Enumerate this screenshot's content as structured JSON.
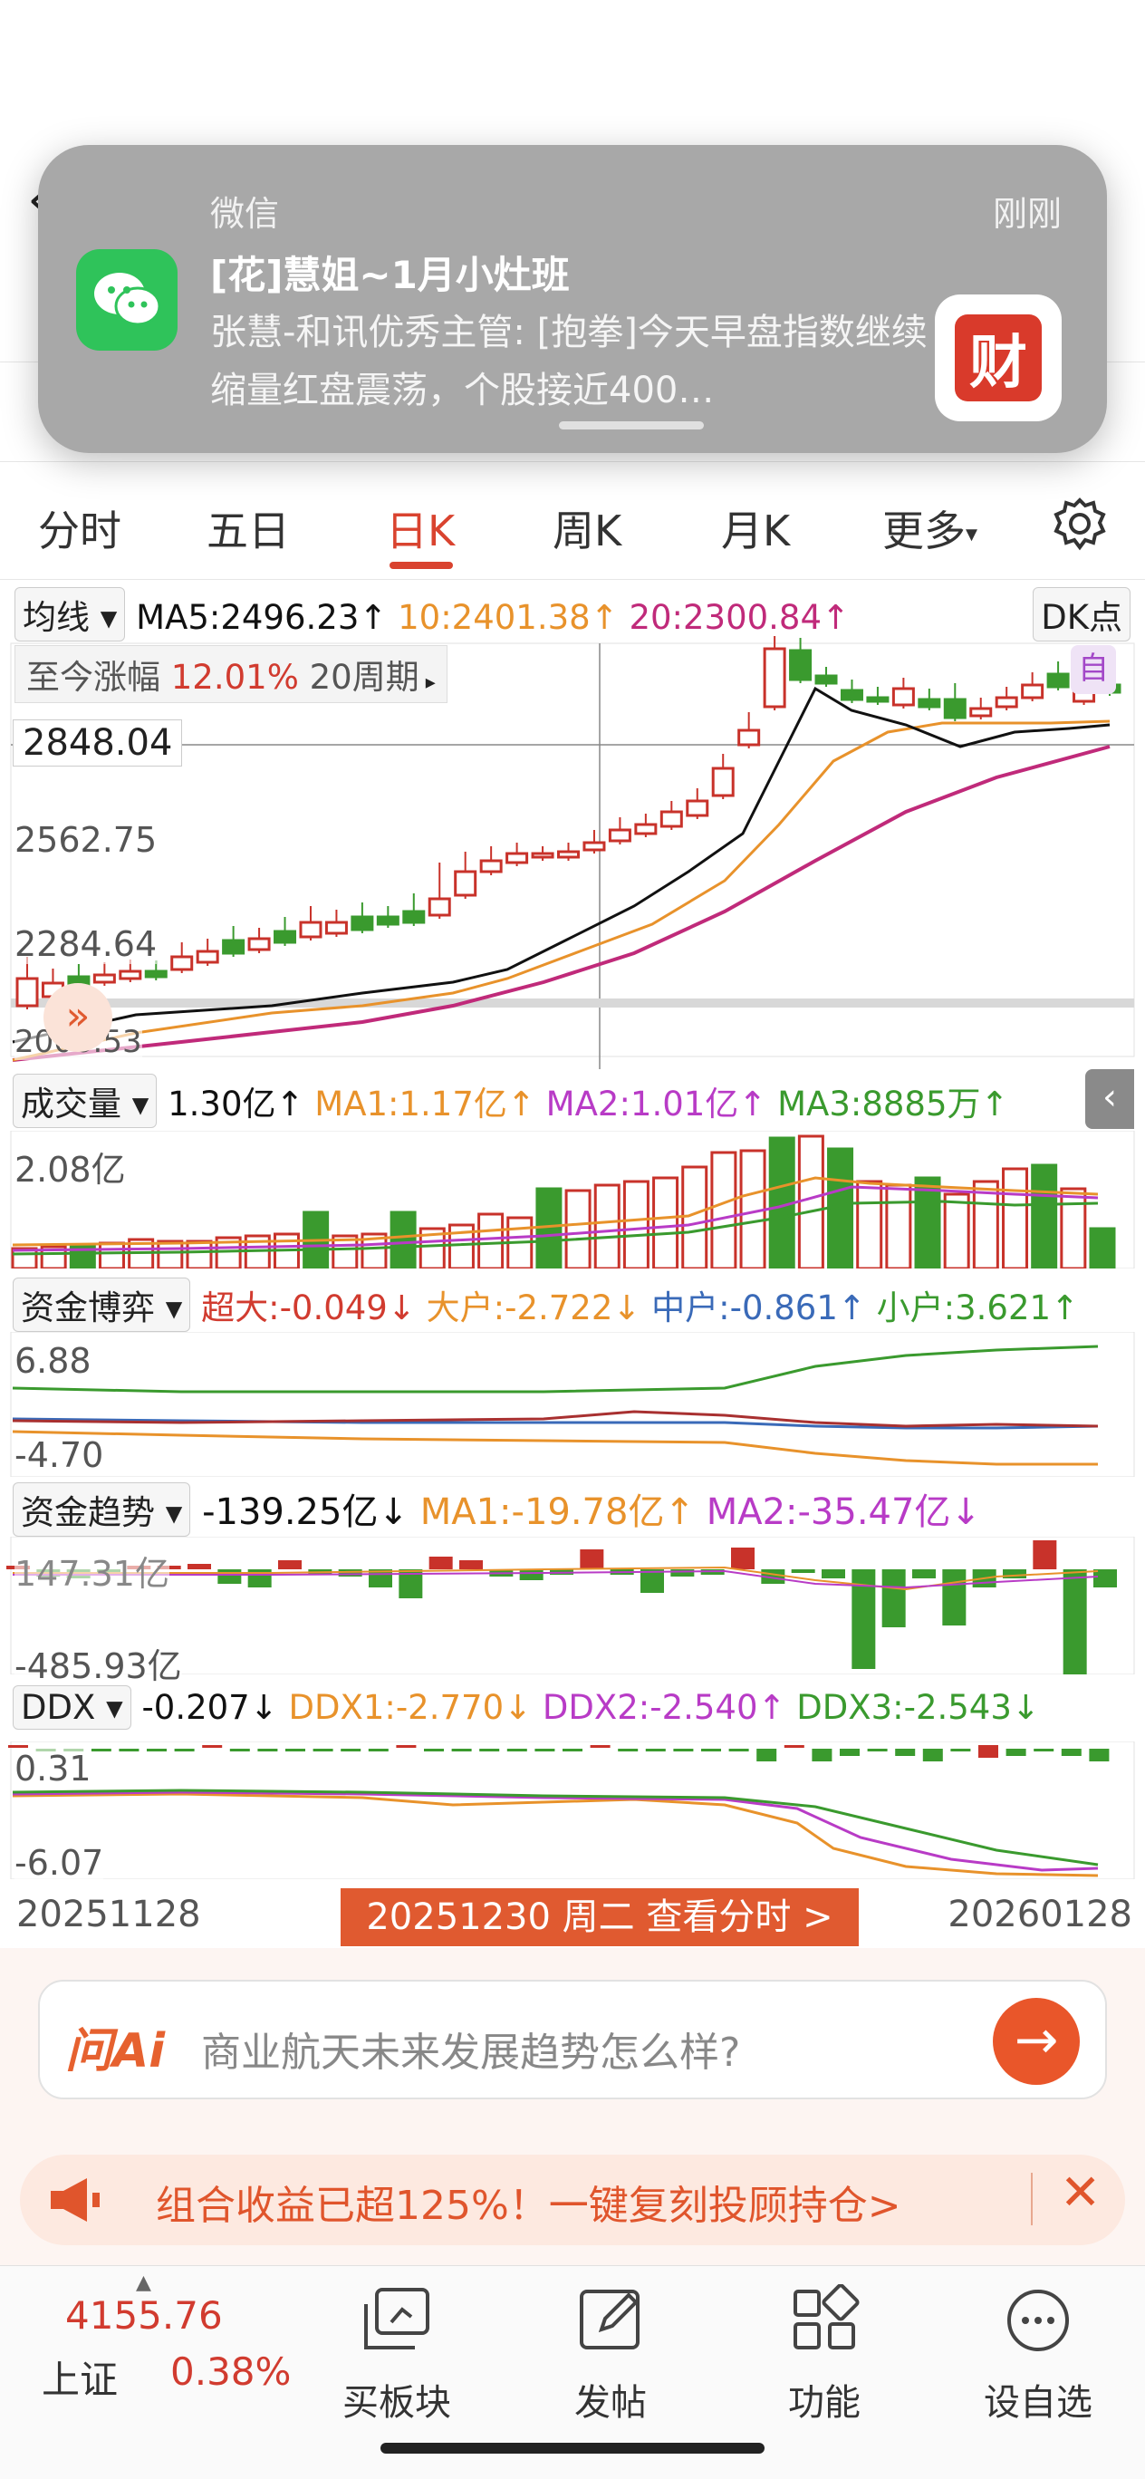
{
  "notification": {
    "app_name": "微信",
    "time": "刚刚",
    "title": "[花]慧姐~1月小灶班",
    "body": "张慧-和讯优秀主管: [抱拳]今天早盘指数继续缩量红盘震荡，个股接近400…",
    "app_icon": "wechat-icon",
    "sender_icon": "财"
  },
  "tabs": [
    {
      "label": "分时"
    },
    {
      "label": "五日"
    },
    {
      "label": "日K"
    },
    {
      "label": "周K"
    },
    {
      "label": "月K"
    },
    {
      "label": "更多"
    }
  ],
  "active_tab": "日K",
  "ma_line": {
    "selector": "均线",
    "ma5": "MA5:2496.23↑",
    "ma10": "10:2401.38↑",
    "ma20": "20:2300.84↑",
    "dk_button": "DK点"
  },
  "kline": {
    "gain_label": "至今涨幅",
    "gain_value": "12.01%",
    "period_label": "20周期",
    "crosshair_price": "2848.04",
    "axis_labels": [
      "2562.75",
      "2284.64",
      "2006.53"
    ],
    "self_label": "自"
  },
  "volume": {
    "selector": "成交量",
    "value": "1.30亿↑",
    "ma1": "MA1:1.17亿↑",
    "ma2": "MA2:1.01亿↑",
    "ma3": "MA3:8885万↑",
    "axis_top": "2.08亿"
  },
  "capital_game": {
    "selector": "资金博弈",
    "super": "超大:-0.049↓",
    "large": "大户:-2.722↓",
    "medium": "中户:-0.861↑",
    "small": "小户:3.621↑",
    "axis_top": "6.88",
    "axis_bottom": "-4.70"
  },
  "capital_trend": {
    "selector": "资金趋势",
    "value": "-139.25亿↓",
    "ma1": "MA1:-19.78亿↑",
    "ma2": "MA2:-35.47亿↓",
    "axis_top": "147.31亿",
    "axis_bottom": "-485.93亿"
  },
  "ddx": {
    "selector": "DDX",
    "value": "-0.207↓",
    "ddx1": "DDX1:-2.770↓",
    "ddx2": "DDX2:-2.540↑",
    "ddx3": "DDX3:-2.543↓",
    "axis_top": "0.31",
    "axis_bottom": "-6.07"
  },
  "date_range": {
    "start": "20251128",
    "end": "20260128",
    "selected": "20251230 周二 查看分时 >"
  },
  "ai_box": {
    "logo": "问Ai",
    "prompt": "商业航天未来发展趋势怎么样?"
  },
  "promo": {
    "text": "组合收益已超125%！一键复刻投顾持仓>"
  },
  "bottom_bar": {
    "index_value": "4155.76",
    "index_name": "上证",
    "index_change": "0.38%",
    "items": [
      {
        "label": "买板块",
        "icon": "sector-icon"
      },
      {
        "label": "发帖",
        "icon": "edit-icon"
      },
      {
        "label": "功能",
        "icon": "grid-icon"
      },
      {
        "label": "设自选",
        "icon": "more-icon"
      }
    ]
  },
  "colors": {
    "up": "#c8322a",
    "down": "#3a9a2e",
    "ma5": "#111111",
    "ma10": "#e8922b",
    "ma20": "#c02a7a",
    "accent": "#d9432f"
  },
  "chart_data": {
    "type": "candlestick",
    "description_series": [
      {
        "name": "MA5",
        "values": [
          2496.23
        ]
      },
      {
        "name": "10",
        "values": [
          2401.38
        ]
      },
      {
        "name": "20",
        "values": [
          2300.84
        ]
      }
    ],
    "x_range": [
      "20251128",
      "20260128"
    ],
    "y_ticks": [
      2562.75,
      2284.64,
      2006.53
    ]
  }
}
